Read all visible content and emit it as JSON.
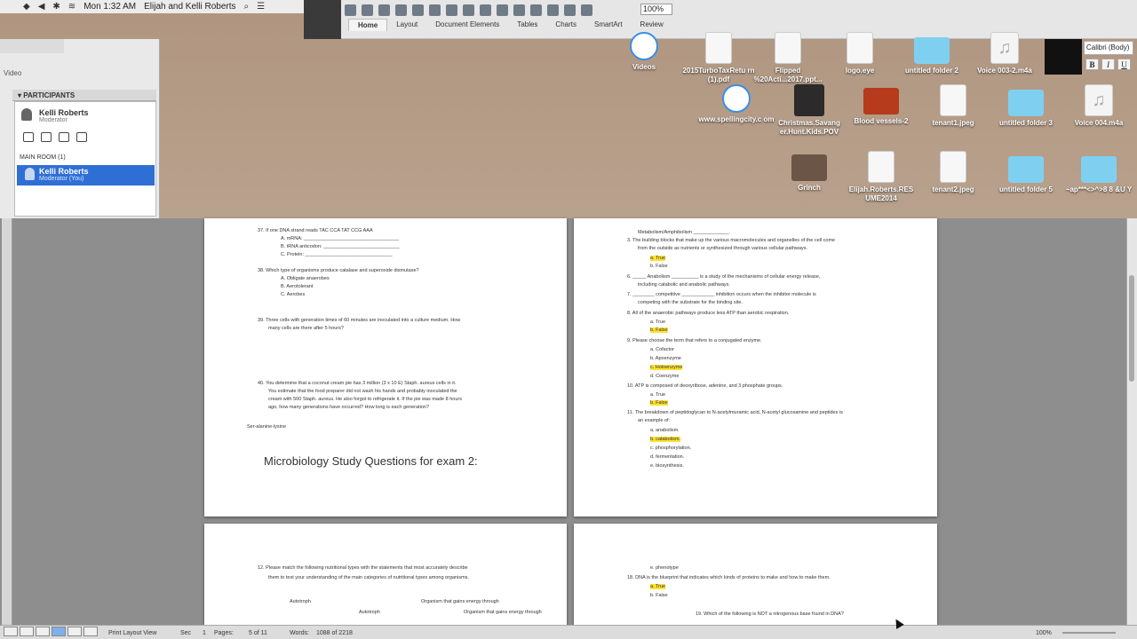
{
  "menubar": {
    "time": "Mon 1:32 AM",
    "user": "Elijah and Kelli Roberts"
  },
  "ribbon": {
    "tabs": [
      "Home",
      "Layout",
      "Document Elements",
      "Tables",
      "Charts",
      "SmartArt",
      "Review"
    ],
    "active_tab": "Home",
    "zoom": "100%",
    "font_name": "Calibri (Body)",
    "bold": "B",
    "italic": "I",
    "underline": "U"
  },
  "desktop_icons": [
    {
      "label": "Videos",
      "kind": "safari"
    },
    {
      "label": "2015TurboTaxRetu rn (1).pdf",
      "kind": "doc"
    },
    {
      "label": "Flipped %20Acti...2017.ppt...",
      "kind": "doc"
    },
    {
      "label": "logo.eye",
      "kind": "doc"
    },
    {
      "label": "untitled folder 2",
      "kind": "folder"
    },
    {
      "label": "Voice 003-2.m4a",
      "kind": "audio"
    },
    {
      "label": "www.spellingcity.c om",
      "kind": "safari"
    },
    {
      "label": "Christmas.Savang er.Hunt.Kids.POV",
      "kind": "photo"
    },
    {
      "label": "Blood vessels-2",
      "kind": "red"
    },
    {
      "label": "tenant1.jpeg",
      "kind": "doc"
    },
    {
      "label": "untitled folder 3",
      "kind": "folder"
    },
    {
      "label": "Voice 004.m4a",
      "kind": "audio"
    },
    {
      "label": "Grinch",
      "kind": "grinch"
    },
    {
      "label": "Elijah.Roberts.RES UME2014",
      "kind": "doc"
    },
    {
      "label": "tenant2.jpeg",
      "kind": "doc"
    },
    {
      "label": "untitled folder 5",
      "kind": "folder"
    },
    {
      "label": "~ap***<>^>8 8 &U Y",
      "kind": "folder"
    }
  ],
  "conference": {
    "video_tab": "Video",
    "participants_header": "PARTICIPANTS",
    "moderator_name": "Kelli Roberts",
    "moderator_role": "Moderator",
    "main_room_label": "MAIN ROOM (1)",
    "room_member_name": "Kelli Roberts",
    "room_member_role": "Moderator (You)"
  },
  "page1": {
    "lines": [
      "37.   If one DNA strand reads TAC CCA TAT CCG AAA",
      "A.    mRNA: ___________________________________",
      "B.    tRNA anticodon: ____________________________",
      "C.    Protein: ________________________________",
      "38.   Which type of organisms produce catalase and superoxide dismutase?",
      "A.    Obligate anaerobes",
      "B.    Aerotolerant",
      "C.    Aerobes",
      "39.   Three cells with generation times of 60 minutes are inoculated into a culture medium. How",
      "many cells are there after 5 hours?",
      "40.   You determine that a coconut cream pie has 3 million (3 x 10 E) Staph. aureus cells in it.",
      "You estimate that the food preparer did not wash his hands and probably inoculated the",
      "cream with 500 Staph. aureus. He also forgot to refrigerate it. If the pie was made 8 hours",
      "ago, how many generations have occurred? How long is each generation?",
      "Ser-alanine-lysine"
    ],
    "heading": "Microbiology Study Questions for exam 2:"
  },
  "page2": {
    "lines": [
      "Metabolism/Amphibolism _____________.",
      "3.   The building blocks that make up the various macromolecules and organelles of the cell come",
      "from the outside as nutrients or synthesized through various cellular pathways.",
      "a.   True",
      "b.   False",
      "6.   _____ Anabolism __________ is a study of the mechanisms of cellular energy release,",
      "including catabolic and anabolic pathways.",
      "7.   ________ competitive ____________ inhibition occurs when the inhibitor molecule is",
      "competing with the substrate for the binding site.",
      "8.   All of the anaerobic pathways produce less ATP than aerobic respiration.",
      "a.   True",
      "b.   False",
      "9.   Please choose the term that refers to a conjugated enzyme.",
      "a.   Cofactor",
      "b.   Apoenzyme",
      "c.   Holoenzyme",
      "d.   Coenzyme",
      "10.  ATP is composed of deoxyribose, adenine, and 3 phosphate groups.",
      "a.   True",
      "b.   False",
      "11.  The breakdown of peptidoglycan to N-acetylmuramic acid, N-acetyl glucosamine and peptides is",
      "an example of:",
      "a.   anabolism.",
      "b.   catabolism.",
      "c.   phosphorylation.",
      "d.   fermentation.",
      "e.   biosynthesis."
    ]
  },
  "page3": {
    "lines": [
      "12.   Please match the following nutritional types with the statements that most accurately describe",
      "them to test your understanding of the main categories of nutritional types among organisms.",
      "Autotroph",
      "Organism that gains energy through",
      "Autotroph",
      "Organism that gains energy through"
    ]
  },
  "page4": {
    "lines": [
      "e.   phenotype",
      "18.   DNA is the blueprint that indicates which kinds of proteins to make and how to make them.",
      "a.   True",
      "b.   False",
      "19.   Which of the following is NOT a nitrogenous base found in DNA?"
    ]
  },
  "status": {
    "view": "Print Layout View",
    "sec_label": "Sec",
    "sec": "1",
    "pages_label": "Pages:",
    "pages": "5 of 11",
    "words_label": "Words:",
    "words": "1088 of 2218",
    "zoom": "100%"
  }
}
